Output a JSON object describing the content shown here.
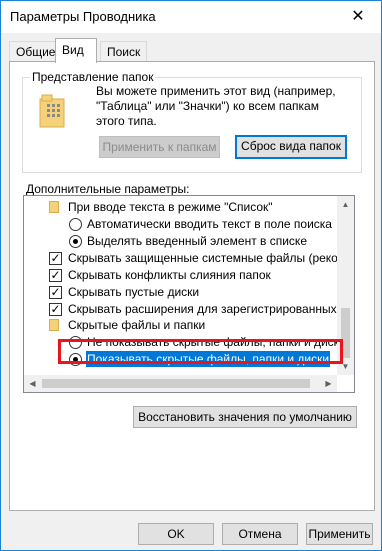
{
  "window": {
    "title": "Параметры Проводника",
    "close_glyph": "✕"
  },
  "tabs": [
    {
      "label": "Общие"
    },
    {
      "label": "Вид"
    },
    {
      "label": "Поиск"
    }
  ],
  "folder_views": {
    "legend": "Представление папок",
    "description_line1": "Вы можете применить этот вид (например,",
    "description_line2": "\"Таблица\" или \"Значки\") ко всем папкам",
    "description_line3": "этого типа.",
    "apply_button": "Применить к папкам",
    "reset_button": "Сброс вида папок"
  },
  "advanced": {
    "label": "Дополнительные параметры:",
    "items": [
      {
        "kind": "folder",
        "label": "При вводе текста в режиме \"Список\""
      },
      {
        "kind": "radio",
        "checked": false,
        "label": "Автоматически вводить текст в поле поиска"
      },
      {
        "kind": "radio",
        "checked": true,
        "label": "Выделять введенный элемент в списке"
      },
      {
        "kind": "check",
        "checked": true,
        "label": "Скрывать защищенные системные файлы (рекомен"
      },
      {
        "kind": "check",
        "checked": true,
        "label": "Скрывать конфликты слияния папок"
      },
      {
        "kind": "check",
        "checked": true,
        "label": "Скрывать пустые диски"
      },
      {
        "kind": "check",
        "checked": true,
        "label": "Скрывать расширения для зарегистрированных типо"
      },
      {
        "kind": "folder",
        "label": "Скрытые файлы и папки"
      },
      {
        "kind": "radio",
        "checked": false,
        "label": "Не показывать скрытые файлы, папки и диски"
      },
      {
        "kind": "radio",
        "checked": true,
        "selected": true,
        "label": "Показывать скрытые файлы, папки и диски"
      }
    ]
  },
  "restore_button": "Восстановить значения по умолчанию",
  "footer": {
    "ok": "OK",
    "cancel": "Отмена",
    "apply": "Применить"
  },
  "colors": {
    "accent": "#0078d7",
    "highlight_box": "#e8141e"
  }
}
